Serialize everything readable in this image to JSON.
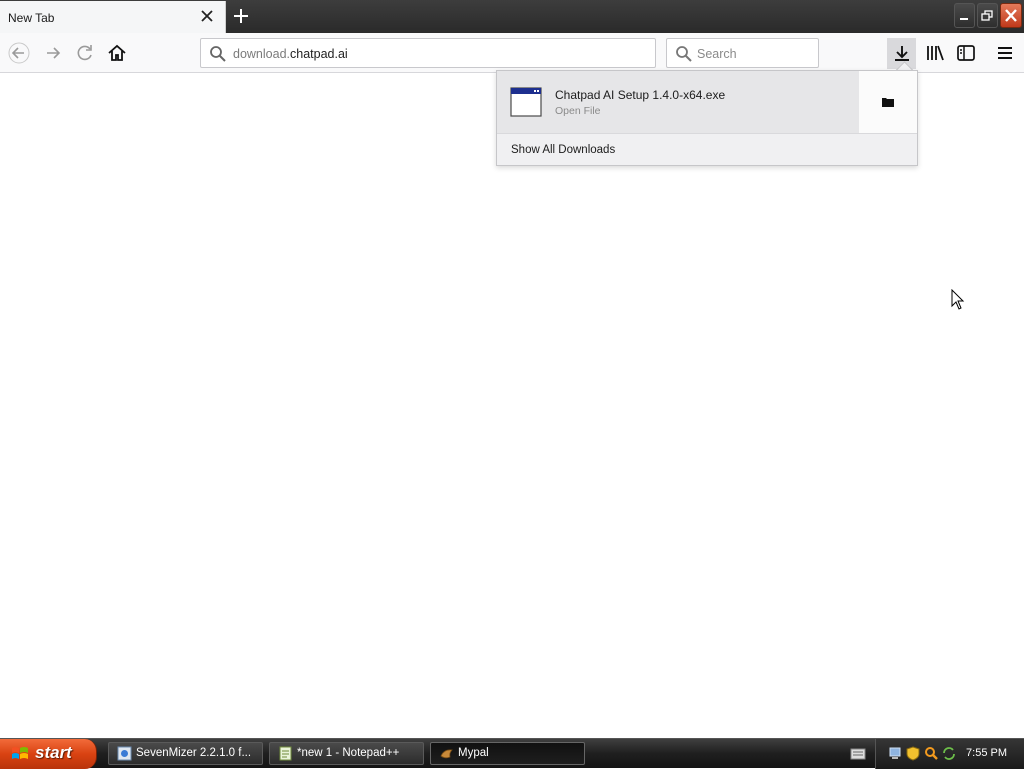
{
  "browser": {
    "tab": {
      "title": "New Tab"
    },
    "url": {
      "prefix": "download.",
      "domain": "chatpad.ai"
    },
    "search": {
      "placeholder": "Search"
    }
  },
  "downloads_panel": {
    "items": [
      {
        "filename": "Chatpad AI Setup 1.4.0-x64.exe",
        "status": "Open File"
      }
    ],
    "show_all_label": "Show All Downloads"
  },
  "taskbar": {
    "start_label": "start",
    "tasks": [
      {
        "label": "SevenMizer 2.2.1.0 f...",
        "icon": "sevenmizer-icon",
        "active": false
      },
      {
        "label": "*new 1 - Notepad++",
        "icon": "notepad-icon",
        "active": false
      },
      {
        "label": "Mypal",
        "icon": "mypal-icon",
        "active": true
      }
    ],
    "clock": "7:55 PM"
  },
  "colors": {
    "start_button": "#d94312",
    "taskbar": "#1f1f1f",
    "close_button": "#c0391b"
  }
}
